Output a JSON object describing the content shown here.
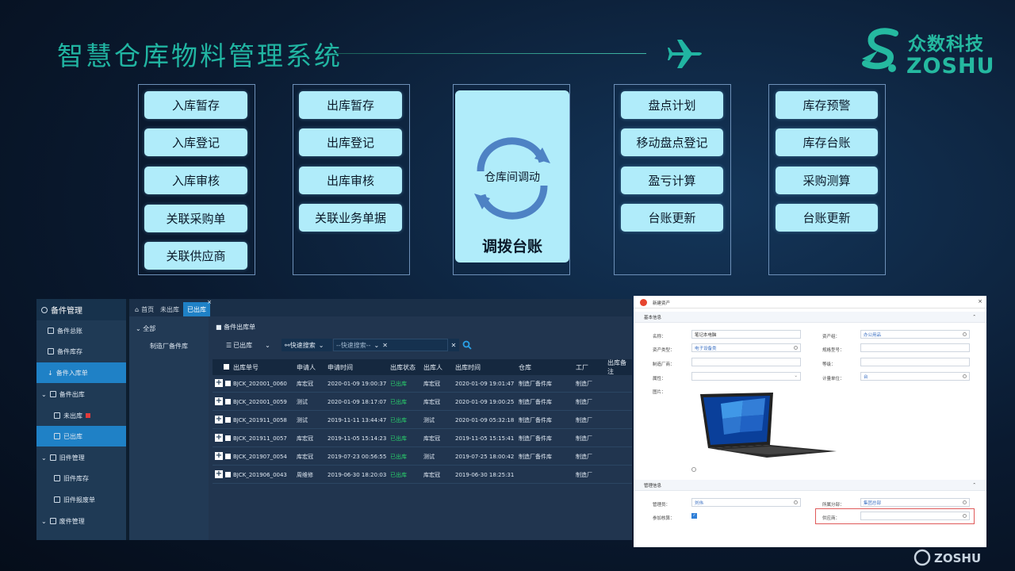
{
  "slide": {
    "title": "智慧仓库物料管理系统",
    "logo_cn": "众数科技",
    "logo_en": "ZOSHU",
    "footer_logo": "ZOSHU"
  },
  "columns": [
    {
      "buttons": [
        "入库暂存",
        "入库登记",
        "入库审核",
        "关联采购单",
        "关联供应商"
      ]
    },
    {
      "buttons": [
        "出库暂存",
        "出库登记",
        "出库审核",
        "关联业务单据"
      ]
    },
    {
      "cycle_label": "仓库间调动",
      "big_label": "调拨台账"
    },
    {
      "buttons": [
        "盘点计划",
        "移动盘点登记",
        "盈亏计算",
        "台账更新"
      ]
    },
    {
      "buttons": [
        "库存预警",
        "库存台账",
        "采购测算",
        "台账更新"
      ]
    }
  ],
  "app": {
    "sidebar_title": "备件管理",
    "sidebar": [
      {
        "label": "备件总账"
      },
      {
        "label": "备件库存"
      },
      {
        "label": "备件入库单"
      },
      {
        "label": "备件出库"
      },
      {
        "label": "未出库"
      },
      {
        "label": "已出库"
      },
      {
        "label": "旧件管理"
      },
      {
        "label": "旧件库存"
      },
      {
        "label": "旧件报废单"
      },
      {
        "label": "废件管理"
      }
    ],
    "tabs": [
      "首页",
      "未出库",
      "已出库"
    ],
    "tree": {
      "root": "全部",
      "child": "制造厂备件库"
    },
    "main_header": "备件出库单",
    "filter": {
      "status": "已出库",
      "quick_search": "快速搜索",
      "quick_placeholder": "--快速搜索--"
    },
    "columns": [
      "出库单号",
      "申请人",
      "申请时间",
      "出库状态",
      "出库人",
      "出库时间",
      "仓库",
      "工厂",
      "出库备注"
    ],
    "rows": [
      [
        "BJCK_202001_0060",
        "库宏冠",
        "2020-01-09 19:00:37",
        "已出库",
        "库宏冠",
        "2020-01-09 19:01:47",
        "制造厂备件库",
        "制造厂"
      ],
      [
        "BJCK_202001_0059",
        "测试",
        "2020-01-09 18:17:07",
        "已出库",
        "库宏冠",
        "2020-01-09 19:00:25",
        "制造厂备件库",
        "制造厂"
      ],
      [
        "BJCK_201911_0058",
        "测试",
        "2019-11-11 13:44:47",
        "已出库",
        "测试",
        "2020-01-09 05:32:18",
        "制造厂备件库",
        "制造厂"
      ],
      [
        "BJCK_201911_0057",
        "库宏冠",
        "2019-11-05 15:14:23",
        "已出库",
        "库宏冠",
        "2019-11-05 15:15:41",
        "制造厂备件库",
        "制造厂"
      ],
      [
        "BJCK_201907_0054",
        "库宏冠",
        "2019-07-23 00:56:55",
        "已出库",
        "测试",
        "2019-07-25 18:00:42",
        "制造厂备件库",
        "制造厂"
      ],
      [
        "BJCK_201906_0043",
        "周维修",
        "2019-06-30 18:20:03",
        "已出库",
        "库宏冠",
        "2019-06-30 18:25:31",
        "",
        "制造厂"
      ]
    ]
  },
  "dialog": {
    "title": "新建资产",
    "section_basic": "基本信息",
    "section_manage": "管理信息",
    "fields": {
      "name_label": "名称：",
      "name_value": "笔记本电脑",
      "group_label": "资产组：",
      "group_value": "办公用品",
      "type_label": "资产类型：",
      "type_value": "电子设备类",
      "model_label": "规格型号：",
      "maker_label": "制造厂商：",
      "level_label": "等级：",
      "attr_label": "属性：",
      "unit_label": "计量单位：",
      "unit_value": "台",
      "image_label": "图片："
    },
    "manage": {
      "manager_label": "管理员：",
      "manager_value": "刘伟",
      "dept_label": "所属分部：",
      "dept_value": "集团总部",
      "depr_label": "参加核算：",
      "supplier_label": "供应商："
    }
  }
}
